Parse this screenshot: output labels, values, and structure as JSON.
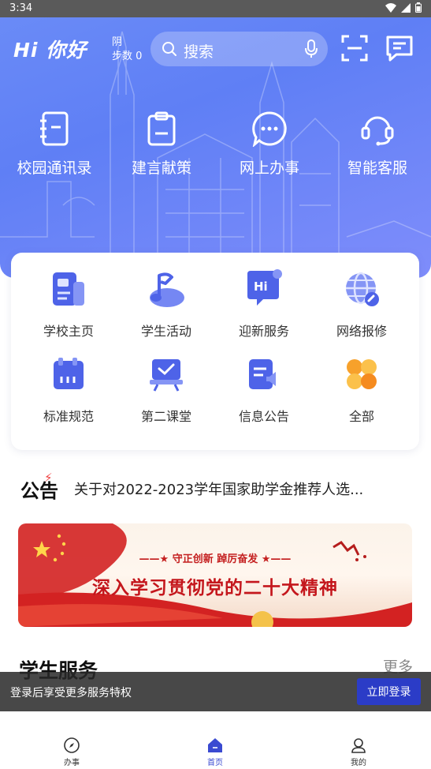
{
  "status": {
    "time": "3:34"
  },
  "header": {
    "greeting": "Hi 你好",
    "weather": "阴",
    "steps": "步数 0",
    "search_placeholder": "搜索"
  },
  "quick_actions": [
    {
      "label": "校园通讯录",
      "icon": "address-book-icon"
    },
    {
      "label": "建言献策",
      "icon": "clipboard-icon"
    },
    {
      "label": "网上办事",
      "icon": "chat-bubble-icon"
    },
    {
      "label": "智能客服",
      "icon": "headset-icon"
    }
  ],
  "services": [
    {
      "label": "学校主页",
      "icon": "school-homepage-icon"
    },
    {
      "label": "学生活动",
      "icon": "student-activity-icon"
    },
    {
      "label": "迎新服务",
      "icon": "welcome-service-icon"
    },
    {
      "label": "网络报修",
      "icon": "network-repair-icon"
    },
    {
      "label": "标准规范",
      "icon": "standards-icon"
    },
    {
      "label": "第二课堂",
      "icon": "second-classroom-icon"
    },
    {
      "label": "信息公告",
      "icon": "announcement-icon"
    },
    {
      "label": "全部",
      "icon": "all-apps-icon"
    }
  ],
  "notice": {
    "badge": "公告",
    "text": "关于对2022-2023学年国家助学金推荐人选..."
  },
  "banner": {
    "subtitle": "——★ 守正创新  踔厉奋发 ★——",
    "title": "深入学习贯彻党的二十大精神"
  },
  "student_services": {
    "title": "学生服务",
    "more": "更多"
  },
  "login_prompt": {
    "text": "登录后享受更多服务特权",
    "button": "立即登录"
  },
  "bottom_nav": [
    {
      "label": "办事",
      "icon": "compass-icon"
    },
    {
      "label": "首页",
      "icon": "home-icon"
    },
    {
      "label": "我的",
      "icon": "profile-icon"
    }
  ],
  "colors": {
    "accent": "#3a4ad1",
    "hero": "#6b8cf7",
    "login_button": "#2b3cc7"
  }
}
